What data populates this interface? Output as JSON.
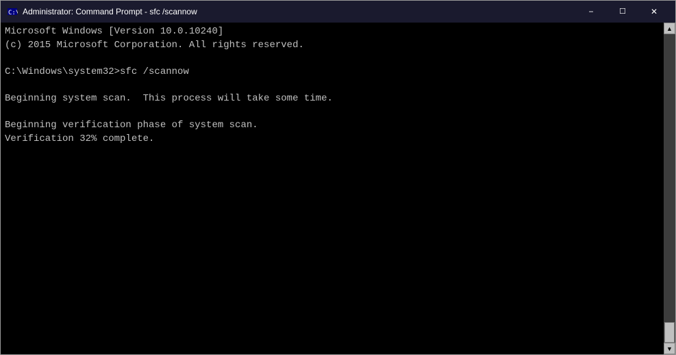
{
  "window": {
    "title": "Administrator: Command Prompt - sfc /scannow",
    "icon": "cmd-icon"
  },
  "titlebar": {
    "minimize_label": "minimize-button",
    "maximize_label": "maximize-button",
    "close_label": "close-button"
  },
  "terminal": {
    "lines": [
      "Microsoft Windows [Version 10.0.10240]",
      "(c) 2015 Microsoft Corporation. All rights reserved.",
      "",
      "C:\\Windows\\system32>sfc /scannow",
      "",
      "Beginning system scan.  This process will take some time.",
      "",
      "Beginning verification phase of system scan.",
      "Verification 32% complete."
    ]
  }
}
